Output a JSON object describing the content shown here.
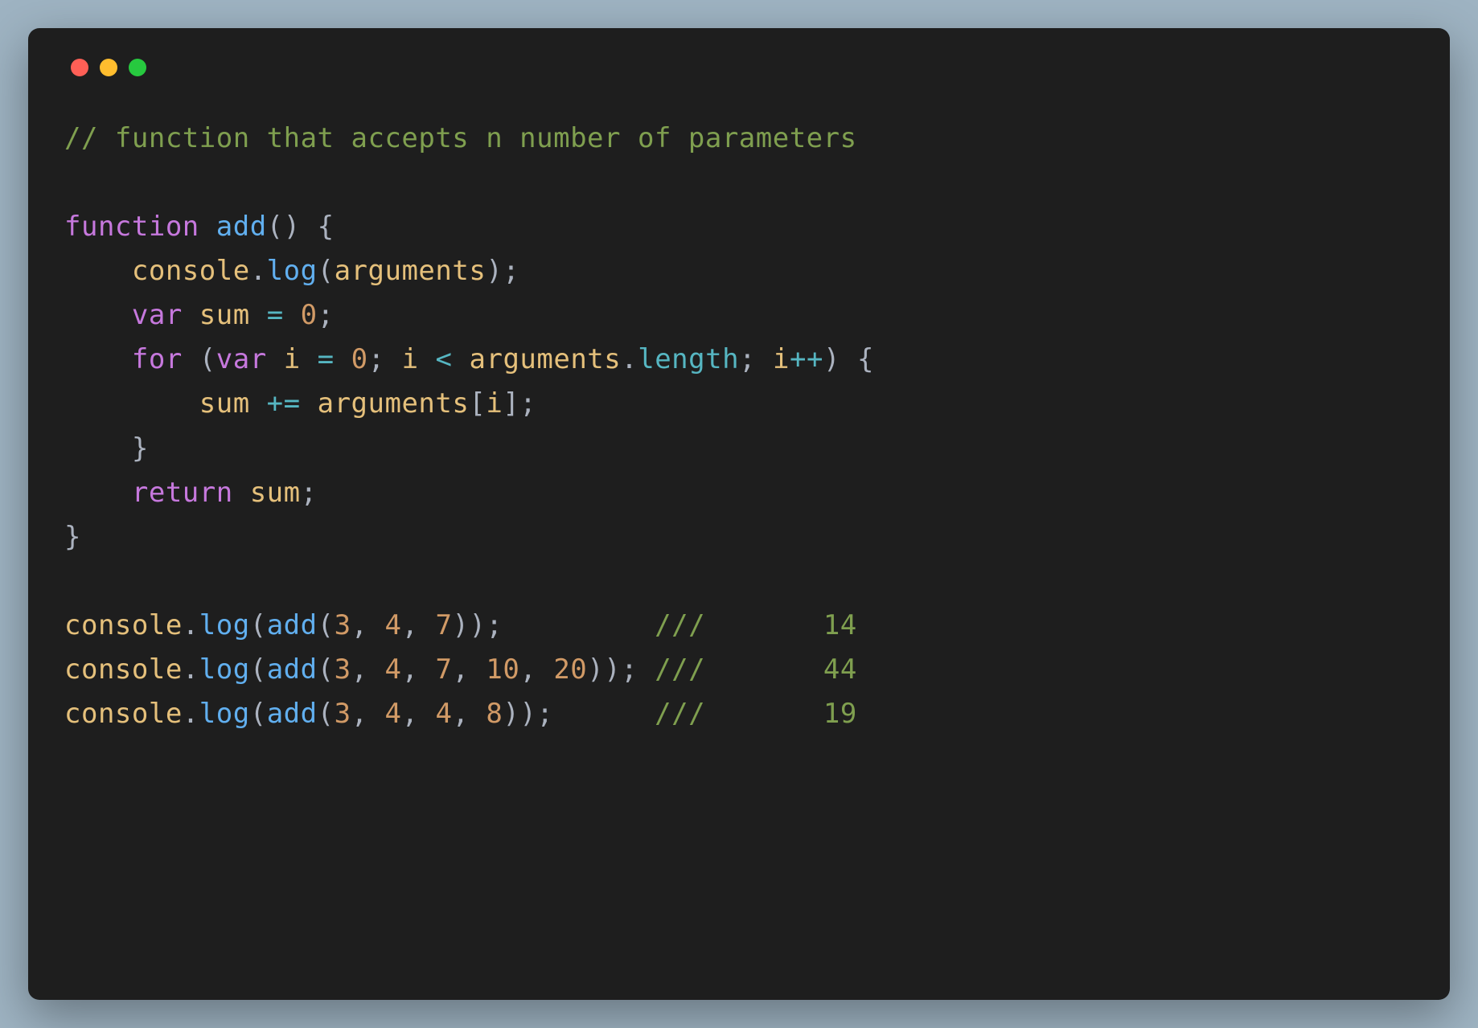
{
  "window": {
    "traffic_lights": [
      "red",
      "yellow",
      "green"
    ]
  },
  "code": {
    "comment1": "// function that accepts n number of parameters",
    "kw_function": "function",
    "fn_add": "add",
    "paren_open": "(",
    "paren_close": ")",
    "brace_open": "{",
    "brace_close": "}",
    "obj_console": "console",
    "dot": ".",
    "fn_log": "log",
    "ident_arguments": "arguments",
    "semicolon": ";",
    "kw_var": "var",
    "ident_sum": "sum",
    "op_assign": "=",
    "num_zero": "0",
    "kw_for": "for",
    "ident_i": "i",
    "op_lt": "<",
    "prop_length": "length",
    "op_inc": "++",
    "op_plus_assign": "+=",
    "bracket_open": "[",
    "bracket_close": "]",
    "kw_return": "return",
    "call1_args": "3, 4, 7",
    "call1_comment": "///       14",
    "call2_args": "3, 4, 7, 10, 20",
    "call2_comment": "///       44",
    "call3_args": "3, 4, 4, 8",
    "call3_comment": "///       19",
    "num_3": "3",
    "num_4": "4",
    "num_7": "7",
    "num_8": "8",
    "num_10": "10",
    "num_20": "20",
    "comma_sp": ", "
  }
}
